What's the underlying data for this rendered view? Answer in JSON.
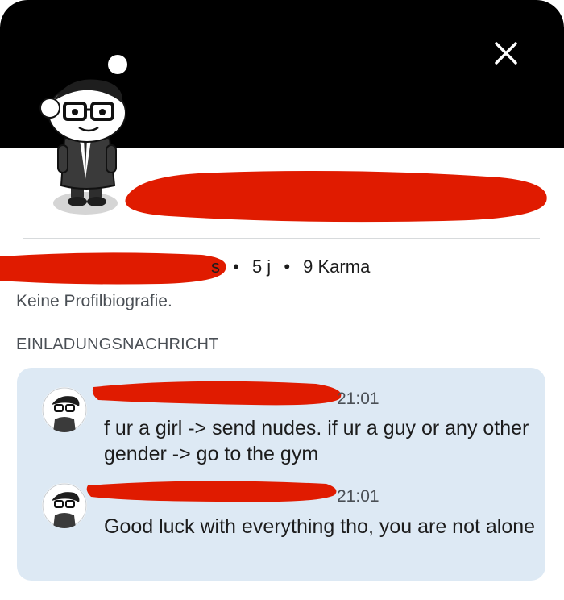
{
  "profile": {
    "meta_suffix": "s",
    "age": "5 j",
    "karma": "9 Karma",
    "separator": "•",
    "bio": "Keine Profilbiografie."
  },
  "invite": {
    "heading": "EINLADUNGSNACHRICHT",
    "messages": [
      {
        "time": "21:01",
        "text": "f ur a girl -> send nudes. if ur a guy or any other gender -> go to the gym"
      },
      {
        "time": "21:01",
        "text": "Good luck with everything tho, you are not alone"
      }
    ]
  },
  "icons": {
    "close": "close-icon",
    "avatar": "snoo-avatar-icon"
  },
  "colors": {
    "banner": "#000000",
    "redaction": "#e01b00",
    "message_bg": "#dde9f4"
  }
}
